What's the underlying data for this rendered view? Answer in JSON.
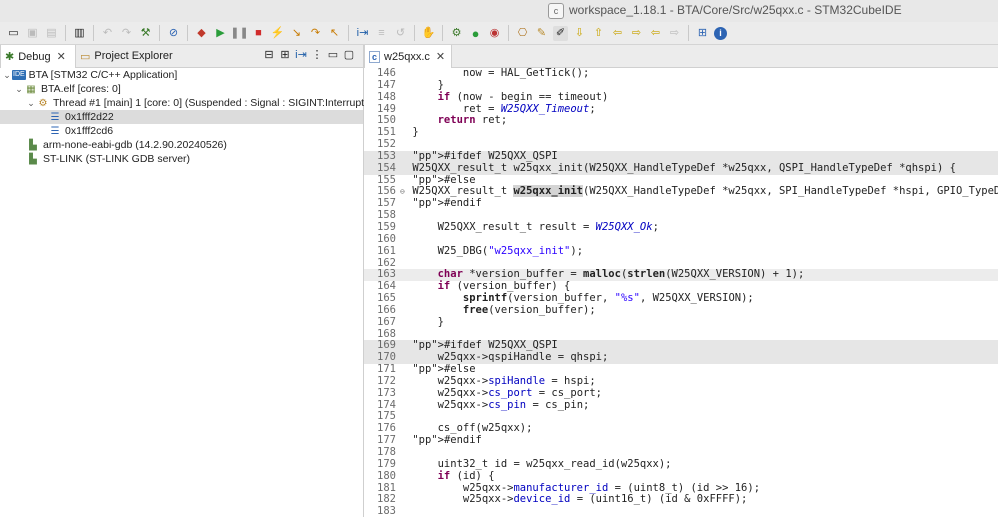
{
  "window": {
    "title": "workspace_1.18.1 - BTA/Core/Src/w25qxx.c - STM32CubeIDE",
    "app_icon": "c"
  },
  "toolbar": {
    "icons": [
      "new-icon",
      "save-icon",
      "save-all-icon",
      "binary-icon",
      "back-icon",
      "forward-icon",
      "build-icon",
      "debug-bug-icon",
      "skip-breakpoints-icon",
      "resume-icon",
      "suspend-icon",
      "terminate-icon",
      "disconnect-icon",
      "step-into-icon",
      "step-over-icon",
      "step-return-icon",
      "instruction-step-icon",
      "drop-frame-icon",
      "restart-icon",
      "external-tools-icon",
      "run-icon",
      "debug-run-icon",
      "open-type-icon",
      "search-icon",
      "highlight-icon",
      "annotation-icon",
      "prev-edit-icon",
      "next-edit-icon",
      "back-history-icon",
      "forward-history-icon",
      "open-perspective-icon",
      "info-icon"
    ]
  },
  "left_tabs": {
    "debug": "Debug",
    "project_explorer": "Project Explorer"
  },
  "debug_tree": [
    {
      "label": "BTA [STM32 C/C++ Application]",
      "icon": "ide-icon",
      "badge": "IDE"
    },
    {
      "label": "BTA.elf [cores: 0]",
      "icon": "elf-icon"
    },
    {
      "label": "Thread #1 [main] 1 [core: 0] (Suspended : Signal : SIGINT:Interrupt)",
      "icon": "thread-icon"
    },
    {
      "label": "0x1fff2d22",
      "icon": "stack-frame-icon"
    },
    {
      "label": "0x1fff2cd6",
      "icon": "stack-frame-icon"
    },
    {
      "label": "arm-none-eabi-gdb (14.2.90.20240526)",
      "icon": "process-icon"
    },
    {
      "label": "ST-LINK (ST-LINK GDB server)",
      "icon": "process-icon"
    }
  ],
  "editor": {
    "tab_label": "w25qxx.c",
    "lines": [
      {
        "n": "146",
        "c": "        now = HAL_GetTick();"
      },
      {
        "n": "147",
        "c": "    }"
      },
      {
        "n": "148",
        "c": "    if (now - begin == timeout)"
      },
      {
        "n": "149",
        "c": "        ret = W25QXX_Timeout;"
      },
      {
        "n": "150",
        "c": "    return ret;"
      },
      {
        "n": "151",
        "c": "}"
      },
      {
        "n": "152",
        "c": ""
      },
      {
        "n": "153",
        "c": "#ifdef W25QXX_QSPI"
      },
      {
        "n": "154",
        "c": "W25QXX_result_t w25qxx_init(W25QXX_HandleTypeDef *w25qxx, QSPI_HandleTypeDef *qhspi) {"
      },
      {
        "n": "155",
        "c": "#else"
      },
      {
        "n": "156",
        "c": "W25QXX_result_t w25qxx_init(W25QXX_HandleTypeDef *w25qxx, SPI_HandleTypeDef *hspi, GPIO_TypeDef *"
      },
      {
        "n": "157",
        "c": "#endif"
      },
      {
        "n": "158",
        "c": ""
      },
      {
        "n": "159",
        "c": "    W25QXX_result_t result = W25QXX_Ok;"
      },
      {
        "n": "160",
        "c": ""
      },
      {
        "n": "161",
        "c": "    W25_DBG(\"w25qxx_init\");"
      },
      {
        "n": "162",
        "c": ""
      },
      {
        "n": "163",
        "c": "    char *version_buffer = malloc(strlen(W25QXX_VERSION) + 1);"
      },
      {
        "n": "164",
        "c": "    if (version_buffer) {"
      },
      {
        "n": "165",
        "c": "        sprintf(version_buffer, \"%s\", W25QXX_VERSION);"
      },
      {
        "n": "166",
        "c": "        free(version_buffer);"
      },
      {
        "n": "167",
        "c": "    }"
      },
      {
        "n": "168",
        "c": ""
      },
      {
        "n": "169",
        "c": "#ifdef W25QXX_QSPI"
      },
      {
        "n": "170",
        "c": "    w25qxx->qspiHandle = qhspi;"
      },
      {
        "n": "171",
        "c": "#else"
      },
      {
        "n": "172",
        "c": "    w25qxx->spiHandle = hspi;"
      },
      {
        "n": "173",
        "c": "    w25qxx->cs_port = cs_port;"
      },
      {
        "n": "174",
        "c": "    w25qxx->cs_pin = cs_pin;"
      },
      {
        "n": "175",
        "c": ""
      },
      {
        "n": "176",
        "c": "    cs_off(w25qxx);"
      },
      {
        "n": "177",
        "c": "#endif"
      },
      {
        "n": "178",
        "c": ""
      },
      {
        "n": "179",
        "c": "    uint32_t id = w25qxx_read_id(w25qxx);"
      },
      {
        "n": "180",
        "c": "    if (id) {"
      },
      {
        "n": "181",
        "c": "        w25qxx->manufacturer_id = (uint8_t) (id >> 16);"
      },
      {
        "n": "182",
        "c": "        w25qxx->device_id = (uint16_t) (id & 0xFFFF);"
      },
      {
        "n": "183",
        "c": ""
      }
    ]
  }
}
